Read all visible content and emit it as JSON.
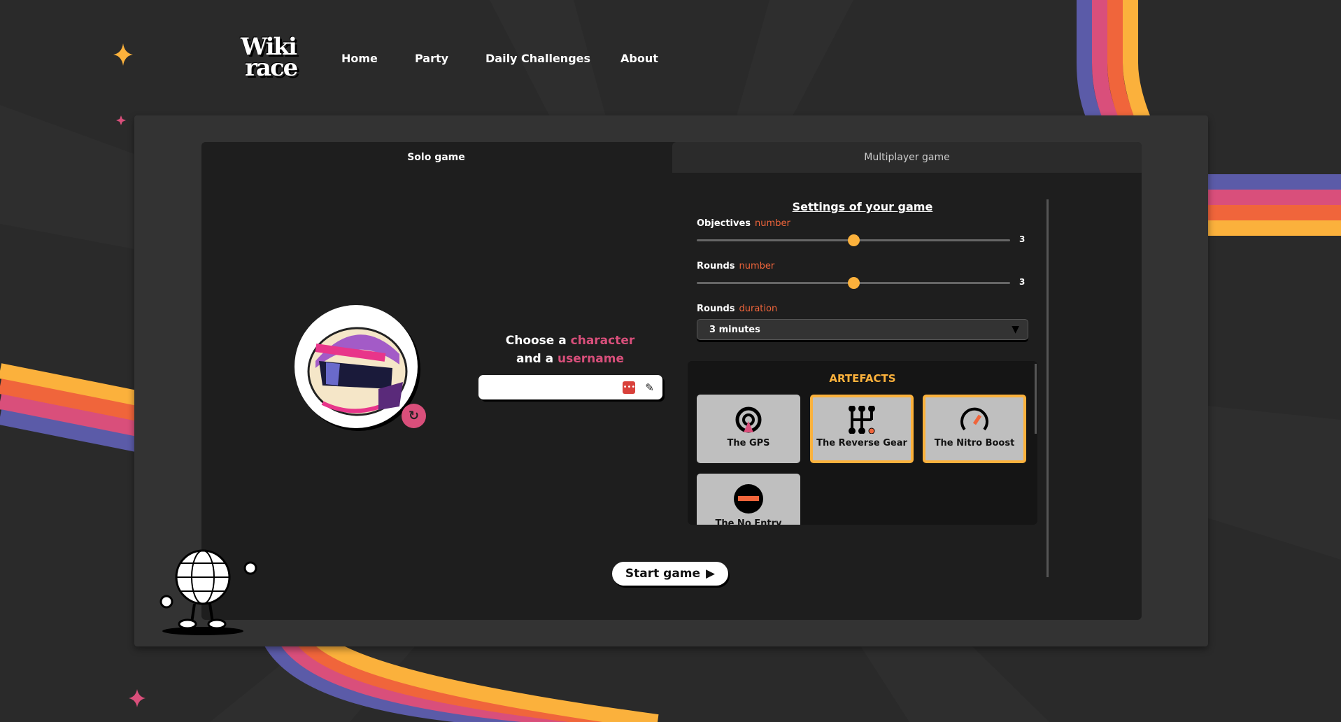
{
  "logo": {
    "text": "Wiki race"
  },
  "nav": {
    "items": [
      "Home",
      "Party",
      "Daily Challenges",
      "About"
    ]
  },
  "tabs": {
    "solo": "Solo game",
    "multiplayer": "Multiplayer game"
  },
  "player": {
    "choose_prefix": "Choose a",
    "choose_character": "character",
    "choose_mid": "and a",
    "choose_username": "username",
    "username_value": ""
  },
  "settings": {
    "title": "Settings of your game",
    "objectives": {
      "label": "Objectives",
      "sub": "number",
      "value": "3",
      "fraction": 0.5
    },
    "rounds": {
      "label": "Rounds",
      "sub": "number",
      "value": "3",
      "fraction": 0.5
    },
    "duration": {
      "label": "Rounds",
      "sub": "duration",
      "value": "3 minutes"
    }
  },
  "artefacts": {
    "title": "ARTEFACTS",
    "items": [
      {
        "name": "The GPS",
        "selected": false
      },
      {
        "name": "The Reverse Gear",
        "selected": true
      },
      {
        "name": "The Nitro Boost",
        "selected": true
      },
      {
        "name": "The No Entry",
        "selected": false
      }
    ]
  },
  "start": {
    "label": "Start game"
  },
  "colors": {
    "accent": "#fbb13c",
    "pink": "#d94f7b",
    "orange": "#f0653b",
    "purple": "#5b5ba8"
  }
}
